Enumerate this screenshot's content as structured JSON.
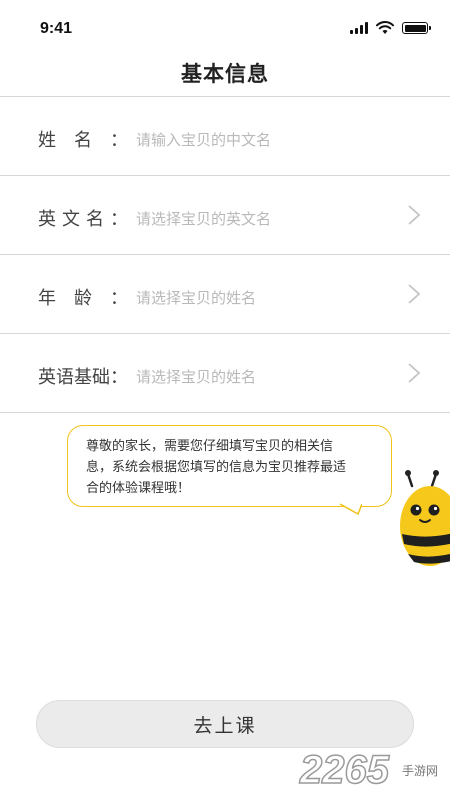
{
  "status_bar": {
    "time": "9:41"
  },
  "header": {
    "title": "基本信息"
  },
  "form": {
    "rows": [
      {
        "label": "姓名",
        "placeholder": "请输入宝贝的中文名",
        "has_chevron": false
      },
      {
        "label": "英文名",
        "placeholder": "请选择宝贝的英文名",
        "has_chevron": true
      },
      {
        "label": "年龄",
        "placeholder": "请选择宝贝的姓名",
        "has_chevron": true
      },
      {
        "label": "英语基础",
        "placeholder": "请选择宝贝的姓名",
        "has_chevron": true
      }
    ],
    "label_colon": "："
  },
  "bubble": {
    "lines": [
      "尊敬的家长，需要您仔细填写宝贝的相关信",
      "息，系统会根据您填写的信息为宝贝推荐最适",
      "合的体验课程哦！"
    ]
  },
  "footer": {
    "button_label": "去上课"
  },
  "watermark": {
    "number": "2265",
    "domain": "手游网"
  },
  "colors": {
    "accent": "#f1c21b",
    "divider": "#d6d6d6",
    "placeholder": "#b9b9b9",
    "button_bg": "#ebebeb"
  },
  "icons": {
    "row_chevron": "chevron-right-icon",
    "mascot": "bee-mascot-icon"
  }
}
